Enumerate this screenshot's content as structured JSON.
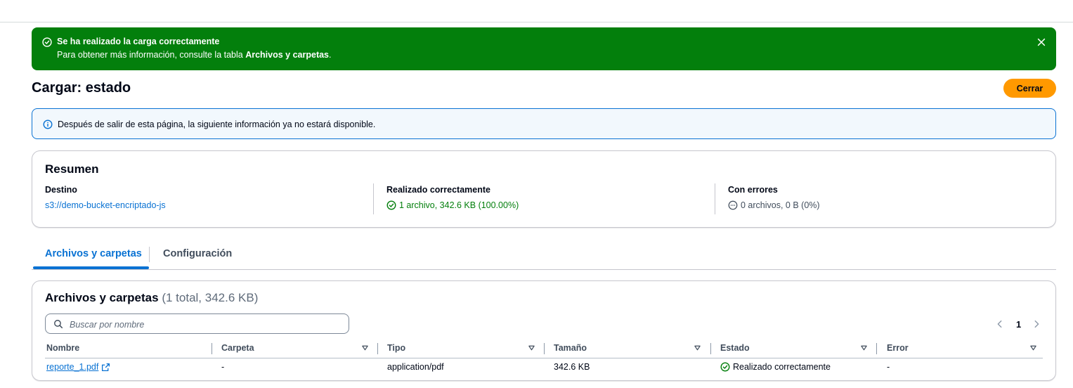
{
  "flash": {
    "title": "Se ha realizado la carga correctamente",
    "message_prefix": "Para obtener más información, consulte la tabla ",
    "message_bold": "Archivos y carpetas",
    "message_suffix": "."
  },
  "header": {
    "title": "Cargar: estado",
    "close_button": "Cerrar"
  },
  "info": {
    "text": "Después de salir de esta página, la siguiente información ya no estará disponible."
  },
  "summary": {
    "title": "Resumen",
    "destination": {
      "label": "Destino",
      "value": "s3://demo-bucket-encriptado-js"
    },
    "succeeded": {
      "label": "Realizado correctamente",
      "value": "1 archivo, 342.6 KB (100.00%)"
    },
    "failed": {
      "label": "Con errores",
      "value": "0 archivos, 0 B (0%)"
    }
  },
  "tabs": [
    {
      "label": "Archivos y carpetas",
      "active": true
    },
    {
      "label": "Configuración",
      "active": false
    }
  ],
  "files": {
    "title": "Archivos y carpetas",
    "count": "(1 total, 342.6 KB)",
    "search_placeholder": "Buscar por nombre",
    "current_page": "1",
    "columns": [
      "Nombre",
      "Carpeta",
      "Tipo",
      "Tamaño",
      "Estado",
      "Error"
    ],
    "rows": [
      {
        "name": "reporte_1.pdf",
        "folder": "-",
        "type": "application/pdf",
        "size": "342.6 KB",
        "status": "Realizado correctamente",
        "error": "-"
      }
    ]
  },
  "colors": {
    "success": "#037f0c",
    "primary_button": "#ff9900",
    "link": "#0972d3",
    "info_background": "#f2f8fd"
  },
  "icons": [
    "check-circle-icon",
    "close-icon",
    "info-icon",
    "minus-circle-icon",
    "search-icon",
    "chevron-left-icon",
    "chevron-right-icon",
    "sort-caret-icon",
    "external-link-icon"
  ]
}
